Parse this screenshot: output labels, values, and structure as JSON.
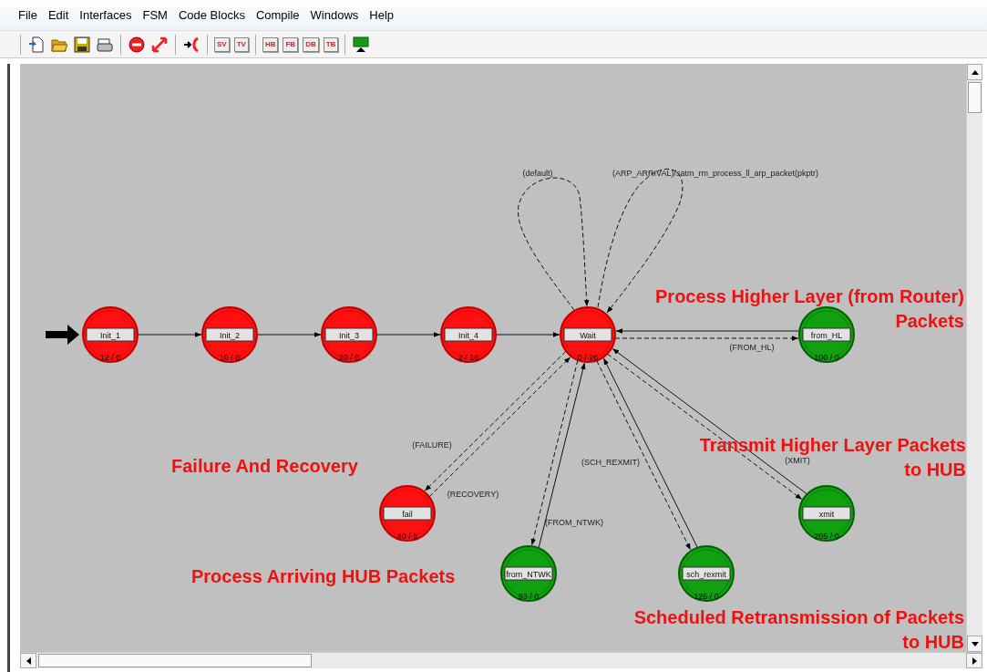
{
  "menu": [
    "File",
    "Edit",
    "Interfaces",
    "FSM",
    "Code Blocks",
    "Compile",
    "Windows",
    "Help"
  ],
  "toolbar": {
    "code_buttons": [
      "SV",
      "TV",
      "HB",
      "FB",
      "DB",
      "TB"
    ]
  },
  "states": [
    {
      "name": "Init_1",
      "counts": "12 / 0",
      "kind": "unforced",
      "initial": true
    },
    {
      "name": "Init_2",
      "counts": "10 / 0",
      "kind": "unforced",
      "initial": false
    },
    {
      "name": "Init_3",
      "counts": "20 / 0",
      "kind": "unforced",
      "initial": false
    },
    {
      "name": "Init_4",
      "counts": "2 / 16",
      "kind": "unforced",
      "initial": false
    },
    {
      "name": "Wait",
      "counts": "0 / 26",
      "kind": "unforced",
      "initial": false
    },
    {
      "name": "from_HL",
      "counts": "100 / 0",
      "kind": "forced",
      "initial": false
    },
    {
      "name": "fail",
      "counts": "40 / 5",
      "kind": "unforced",
      "initial": false
    },
    {
      "name": "from_NTWK",
      "counts": "93 / 0",
      "kind": "forced",
      "initial": false
    },
    {
      "name": "sch_rexmit",
      "counts": "125 / 0",
      "kind": "forced",
      "initial": false
    },
    {
      "name": "xmit",
      "counts": "205 / 0",
      "kind": "forced",
      "initial": false
    }
  ],
  "transitions": [
    {
      "kind": "unconditional"
    },
    {
      "kind": "unconditional"
    },
    {
      "kind": "unconditional"
    },
    {
      "kind": "unconditional"
    },
    {
      "kind": "conditional",
      "label": "(default)"
    },
    {
      "kind": "conditional",
      "label": "(ARP_ARRIVAL)/satm_rm_process_ll_arp_packet(pkptr)"
    },
    {
      "kind": "unconditional"
    },
    {
      "kind": "conditional",
      "label": "(FROM_HL)"
    },
    {
      "kind": "conditional",
      "label": "(FAILURE)"
    },
    {
      "kind": "conditional",
      "label": "(RECOVERY)"
    },
    {
      "kind": "unconditional"
    },
    {
      "kind": "conditional",
      "label": "(FROM_NTWK)"
    },
    {
      "kind": "conditional",
      "label": "(SCH_REXMIT)"
    },
    {
      "kind": "unconditional"
    },
    {
      "kind": "unconditional"
    },
    {
      "kind": "conditional",
      "label": "(XMIT)"
    }
  ],
  "annotations": [
    {
      "lines": [
        "Process Higher Layer (from Router)",
        "Packets"
      ]
    },
    {
      "lines": [
        "Failure And Recovery"
      ]
    },
    {
      "lines": [
        "Transmit Higher Layer Packets",
        "to HUB"
      ]
    },
    {
      "lines": [
        "Process Arriving HUB Packets"
      ]
    },
    {
      "lines": [
        "Scheduled Retransmission of Packets",
        "to HUB"
      ]
    }
  ]
}
